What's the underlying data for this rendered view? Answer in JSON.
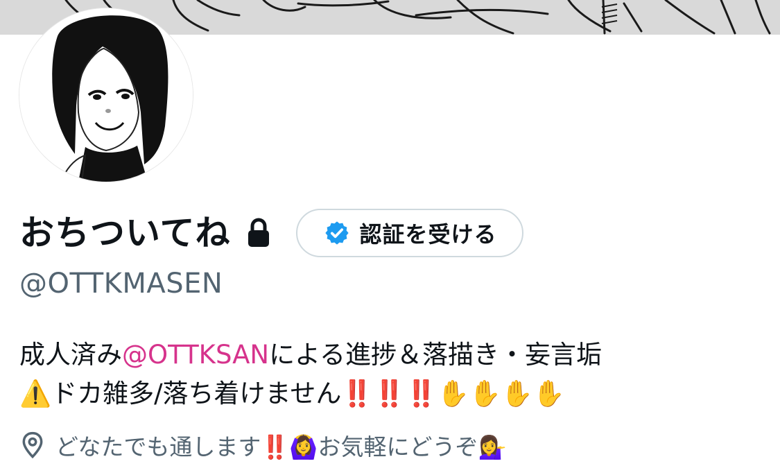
{
  "profile": {
    "display_name": "おちついてね",
    "handle": "@OTTKMASEN",
    "verify_button_label": "認証を受ける",
    "bio": {
      "line1_prefix": "成人済み",
      "line1_mention": "@OTTKSAN",
      "line1_suffix": "による進捗＆落描き・妄言垢",
      "line2": "⚠️ドカ雑多/落ち着けません‼️‼️‼️✋✋✋✋"
    },
    "location": "どなたでも通します‼️🙆‍♀️お気軽にどうぞ💁‍♀️"
  },
  "icons": {
    "lock": "lock-icon",
    "verified": "verified-badge-icon",
    "location": "location-pin-icon"
  },
  "colors": {
    "mention": "#d6338c",
    "secondary_text": "#536471",
    "verified_blue": "#1d9bf0",
    "button_border": "#cfd9de"
  }
}
